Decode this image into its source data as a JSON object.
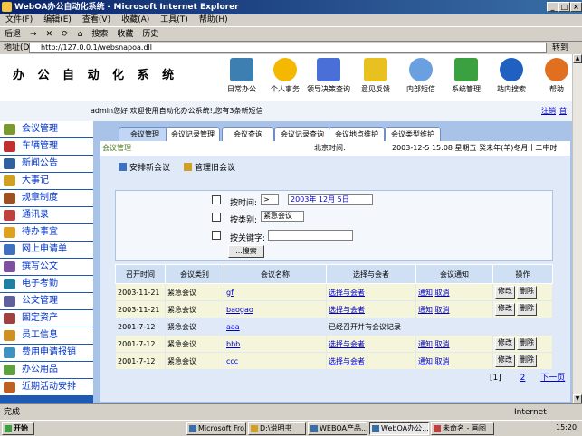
{
  "window": {
    "title": "WebOA办公自动化系统 - Microsoft Internet Explorer",
    "controls": [
      "_",
      "□",
      "×"
    ]
  },
  "menu": [
    "文件(F)",
    "编辑(E)",
    "查看(V)",
    "收藏(A)",
    "工具(T)",
    "帮助(H)"
  ],
  "toolbar": [
    "后退",
    "→",
    "✕",
    "⟳",
    "⌂",
    "搜索",
    "收藏",
    "历史"
  ],
  "address": {
    "label": "地址(D)",
    "url": "http://127.0.0.1/websnapoa.dll",
    "go": "转到"
  },
  "app": {
    "logo": "办 公 自 动 化 系 统",
    "nav": [
      {
        "label": "日常办公",
        "icon": "monitor-icon",
        "color": "#3c7fb0"
      },
      {
        "label": "个人事务",
        "icon": "person-icon",
        "color": "#f5b800"
      },
      {
        "label": "领导决策查询",
        "icon": "apple-icon",
        "color": "#4a6fd6"
      },
      {
        "label": "意见反馈",
        "icon": "chat-icon",
        "color": "#e8c020"
      },
      {
        "label": "内部短信",
        "icon": "key-icon",
        "color": "#6ba0e0"
      },
      {
        "label": "系统管理",
        "icon": "cube-icon",
        "color": "#3aa040"
      },
      {
        "label": "站内搜索",
        "icon": "globe-icon",
        "color": "#2060c0"
      },
      {
        "label": "帮助",
        "icon": "help-icon",
        "color": "#e07020"
      }
    ],
    "welcome": "admin您好,欢迎使用自动化办公系统!,您有3条新短信",
    "logout": "注销",
    "home": "首页",
    "sidebar": [
      {
        "label": "会议管理",
        "color": "#7a9a30"
      },
      {
        "label": "车辆管理",
        "color": "#c03030"
      },
      {
        "label": "新闻公告",
        "color": "#3060a0"
      },
      {
        "label": "大事记",
        "color": "#d0a020"
      },
      {
        "label": "规章制度",
        "color": "#a05020"
      },
      {
        "label": "通讯录",
        "color": "#c04040"
      },
      {
        "label": "待办事宜",
        "color": "#e0a020"
      },
      {
        "label": "网上申请单",
        "color": "#4070c0"
      },
      {
        "label": "撰写公文",
        "color": "#8050a0"
      },
      {
        "label": "电子考勤",
        "color": "#2080a0"
      },
      {
        "label": "公文管理",
        "color": "#6060a0"
      },
      {
        "label": "固定资产",
        "color": "#a04040"
      },
      {
        "label": "员工信息",
        "color": "#d09020"
      },
      {
        "label": "费用申请报销",
        "color": "#4090c0"
      },
      {
        "label": "办公用品",
        "color": "#60a040"
      },
      {
        "label": "近期活动安排",
        "color": "#c06020"
      }
    ],
    "tabs": [
      "会议管理",
      "会议记录管理",
      "会议查询",
      "会议记录查询",
      "会议地点维护",
      "会议类型维护"
    ],
    "breadcrumb": "会议管理",
    "beijing_time_label": "北京时间:",
    "datetime": "2003-12-5 15:08 星期五 癸未年(羊)冬月十二中时",
    "actions": [
      "安排新会议",
      "管理旧会议"
    ],
    "form": {
      "time_label": "按时间:",
      "op": ">",
      "date": "2003年 12月 5日",
      "type_label": "按类别:",
      "type_value": "紧急会议",
      "keyword_label": "按关键字:",
      "search": "...搜索"
    },
    "table": {
      "headers": [
        "召开时间",
        "会议类别",
        "会议名称",
        "选择与会者",
        "会议通知",
        "操作"
      ],
      "rows": [
        {
          "date": "2003-11-21",
          "type": "紧急会议",
          "name": "gf",
          "who": "选择与会者",
          "notice": [
            "通知",
            "取消"
          ],
          "ops": [
            "修改",
            "删除"
          ]
        },
        {
          "date": "2003-11-21",
          "type": "紧急会议",
          "name": "baogao",
          "who": "选择与会者",
          "notice": [
            "通知",
            "取消"
          ],
          "ops": [
            "修改",
            "删除"
          ]
        },
        {
          "date": "2001-7-12",
          "type": "紧急会议",
          "name": "aaa",
          "who": "已经召开并有会议记录",
          "notice": [],
          "ops": []
        },
        {
          "date": "2001-7-12",
          "type": "紧急会议",
          "name": "bbb",
          "who": "选择与会者",
          "notice": [
            "通知",
            "取消"
          ],
          "ops": [
            "修改",
            "删除"
          ]
        },
        {
          "date": "2001-7-12",
          "type": "紧急会议",
          "name": "ccc",
          "who": "选择与会者",
          "notice": [
            "通知",
            "取消"
          ],
          "ops": [
            "修改",
            "删除"
          ]
        }
      ]
    },
    "pager": {
      "current": "[1]",
      "next_page": "2",
      "next": "下一页"
    }
  },
  "status": {
    "done": "完成",
    "zone": "Internet"
  },
  "taskbar": {
    "start": "开始",
    "tasks": [
      "Microsoft Fro...",
      "D:\\说明书",
      "WEBOA产品...",
      "WebOA办公...",
      "未命名 - 画图"
    ],
    "time": "15:20"
  }
}
